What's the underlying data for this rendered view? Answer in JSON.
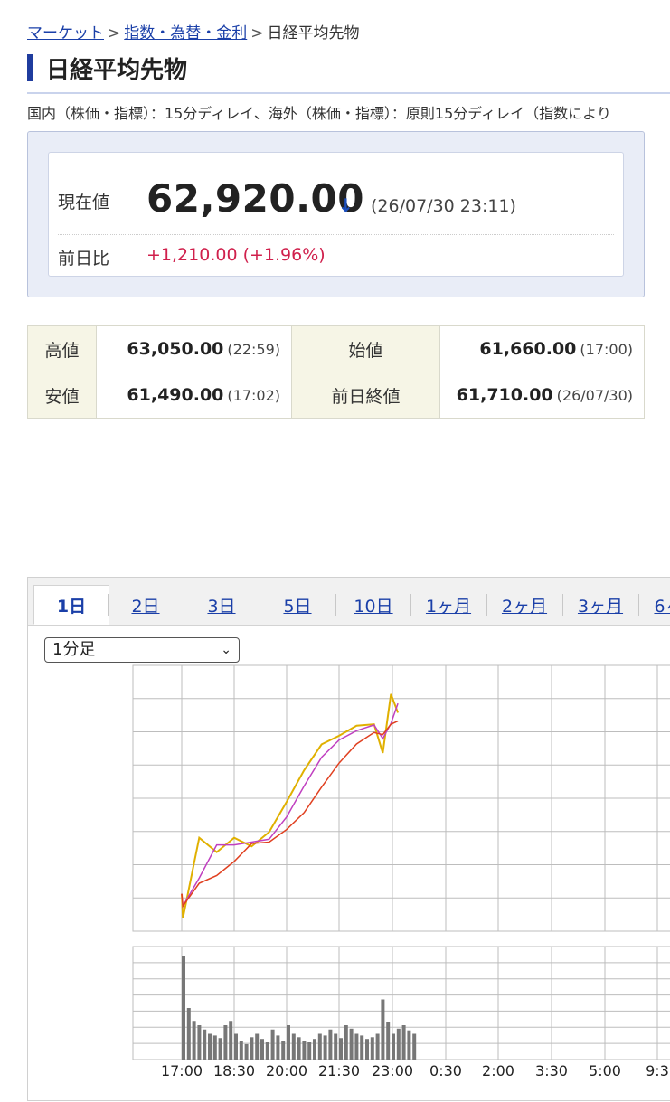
{
  "breadcrumb": {
    "item1": "マーケット",
    "item2": "指数・為替・金利",
    "sep": ">",
    "current": "日経平均先物"
  },
  "page_title": "日経平均先物",
  "notice": "国内（株価・指標）：15分ディレイ、海外（株価・指標）：原則15分ディレイ（指数により",
  "price": {
    "current_label": "現在値",
    "current_value": "62,920.00",
    "arrow": "↓",
    "timestamp": "(26/07/30 23:11)",
    "change_label": "前日比",
    "change_value": "+1,210.00 (+1.96%)",
    "colors": {
      "change": "#d0204c",
      "arrow": "#1a4fc0"
    }
  },
  "stats": {
    "high_label": "高値",
    "high_value": "63,050.00",
    "high_time": "(22:59)",
    "open_label": "始値",
    "open_value": "61,660.00",
    "open_time": "(17:00)",
    "low_label": "安値",
    "low_value": "61,490.00",
    "low_time": "(17:02)",
    "prev_close_label": "前日終値",
    "prev_close_value": "61,710.00",
    "prev_close_date": "(26/07/30)"
  },
  "tabs": [
    {
      "label": "1日",
      "active": true
    },
    {
      "label": "2日"
    },
    {
      "label": "3日"
    },
    {
      "label": "5日"
    },
    {
      "label": "10日"
    },
    {
      "label": "1ヶ月"
    },
    {
      "label": "2ヶ月"
    },
    {
      "label": "3ヶ月"
    },
    {
      "label": "6ヶ"
    }
  ],
  "interval_select": {
    "value": "1分足",
    "icon": "chevron-down-icon"
  },
  "chart_data": {
    "type": "line",
    "x_labels": [
      "17:00",
      "18:30",
      "20:00",
      "21:30",
      "23:00",
      "0:30",
      "2:00",
      "3:30",
      "5:00",
      "9:3"
    ],
    "price_series": {
      "x": [
        "17:00",
        "17:02",
        "17:30",
        "18:00",
        "18:30",
        "19:00",
        "19:30",
        "20:00",
        "20:30",
        "21:00",
        "21:30",
        "22:00",
        "22:30",
        "22:45",
        "22:59",
        "23:11"
      ],
      "y": [
        61660,
        61490,
        62050,
        61950,
        62050,
        61990,
        62090,
        62300,
        62520,
        62700,
        62760,
        62830,
        62840,
        62640,
        63050,
        62920
      ]
    },
    "volume_present": true,
    "colors": {
      "price": "#e0b000",
      "ma_short": "#c040c0",
      "ma_long": "#e04020",
      "volume": "#777777",
      "grid": "#bdbdbd"
    }
  }
}
